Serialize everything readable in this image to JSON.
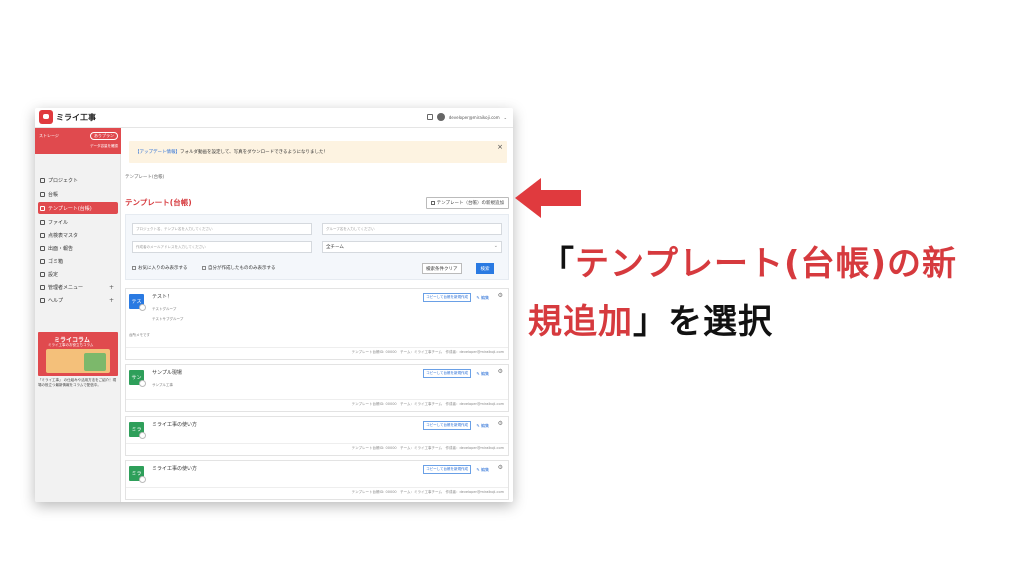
{
  "app": {
    "logo_text": "ミライ工事",
    "user_email": "developer@miraikoji.com"
  },
  "sidebar": {
    "storage_label": "ストレージ",
    "plan_label": "ありプラン",
    "storage_caption": "データ容量を確認",
    "items": [
      {
        "label": "プロジェクト",
        "icon": "folder-icon"
      },
      {
        "label": "台帳",
        "icon": "ledger-icon"
      },
      {
        "label": "テンプレート(台帳)",
        "icon": "template-icon",
        "active": true
      },
      {
        "label": "ファイル",
        "icon": "file-icon"
      },
      {
        "label": "点検表マスタ",
        "icon": "checklist-icon"
      },
      {
        "label": "出面・報告",
        "icon": "report-icon"
      },
      {
        "label": "ゴミ箱",
        "icon": "trash-icon"
      },
      {
        "label": "設定",
        "icon": "gear-icon"
      },
      {
        "label": "管理者メニュー",
        "icon": "admin-icon",
        "expand": "+"
      },
      {
        "label": "ヘルプ",
        "icon": "help-icon",
        "expand": "+"
      }
    ],
    "banner_title": "ミライコラム",
    "banner_subtitle": "ミライ工事のお役立ちコラム",
    "banner_note": "「ミライ工事」 の仕組みや活用方法をご紹介！現場の役立つ最新情報をコラムで配信中。"
  },
  "main": {
    "update_tag": "【アップデート情報】",
    "update_text": "フォルダ動画を設定して、写真をダウンロードできるようになりました！",
    "close_glyph": "×",
    "breadcrumb": "テンプレート(台帳)",
    "page_title": "テンプレート(台帳)",
    "add_button": "テンプレート（台帳）の新規追加",
    "filters": {
      "name_placeholder": "プロジェクト名、テンプレ名を入力してください",
      "group_placeholder": "グループ名を入力してください",
      "creator_placeholder": "作成者のメールアドレスを入力してください",
      "team_value": "全チーム",
      "favorites_label": "お気に入りのみ表示する",
      "mine_label": "自分が作成したもののみ表示する",
      "clear_label": "検索条件クリア",
      "search_label": "検索"
    },
    "card_actions": {
      "copy_label": "コピーして台帳を新規作成",
      "edit_label": "編集",
      "gear_glyph": "⚙"
    },
    "cards": [
      {
        "avatar": "テス",
        "color": "#2a7ae2",
        "title": "テスト！",
        "sub1": "テストグループ",
        "sub2": "テストサブグループ",
        "note": "台所メモです",
        "footer": "テンプレート台帳ID: 00000　チーム：ミライ工事チーム　作成者：developer@miraikoji.com"
      },
      {
        "avatar": "サン",
        "color": "#2e9f5a",
        "title": "サンプル現場",
        "sub1": "サンプル工事",
        "sub2": "",
        "note": "",
        "footer": "テンプレート台帳ID: 00000　チーム：ミライ工事チーム　作成者：developer@miraikoji.com"
      },
      {
        "avatar": "ミラ",
        "color": "#2e9f5a",
        "title": "ミライ工事の使い方",
        "sub1": "",
        "sub2": "",
        "note": "",
        "footer": "テンプレート台帳ID: 00000　チーム：ミライ工事チーム　作成者：developer@miraikoji.com"
      },
      {
        "avatar": "ミラ",
        "color": "#2e9f5a",
        "title": "ミライ工事の使い方",
        "sub1": "",
        "sub2": "",
        "note": "",
        "footer": "テンプレート台帳ID: 00000　チーム：ミライ工事チーム　作成者：developer@miraikoji.com"
      },
      {
        "avatar": "ミラ",
        "color": "#2a7ae2",
        "title": "ミライ工事の使い方",
        "sub1": "",
        "sub2": "",
        "note": "",
        "footer": ""
      }
    ]
  },
  "caption": {
    "line1_open": "「",
    "line1_red": "テンプレート(台帳)の新",
    "line2_red": "規追加",
    "line2_rest": "」を選択"
  },
  "colors": {
    "accent_red": "#d63a3e",
    "link_blue": "#2a6fd6",
    "arrow_red": "#e03a3e"
  }
}
